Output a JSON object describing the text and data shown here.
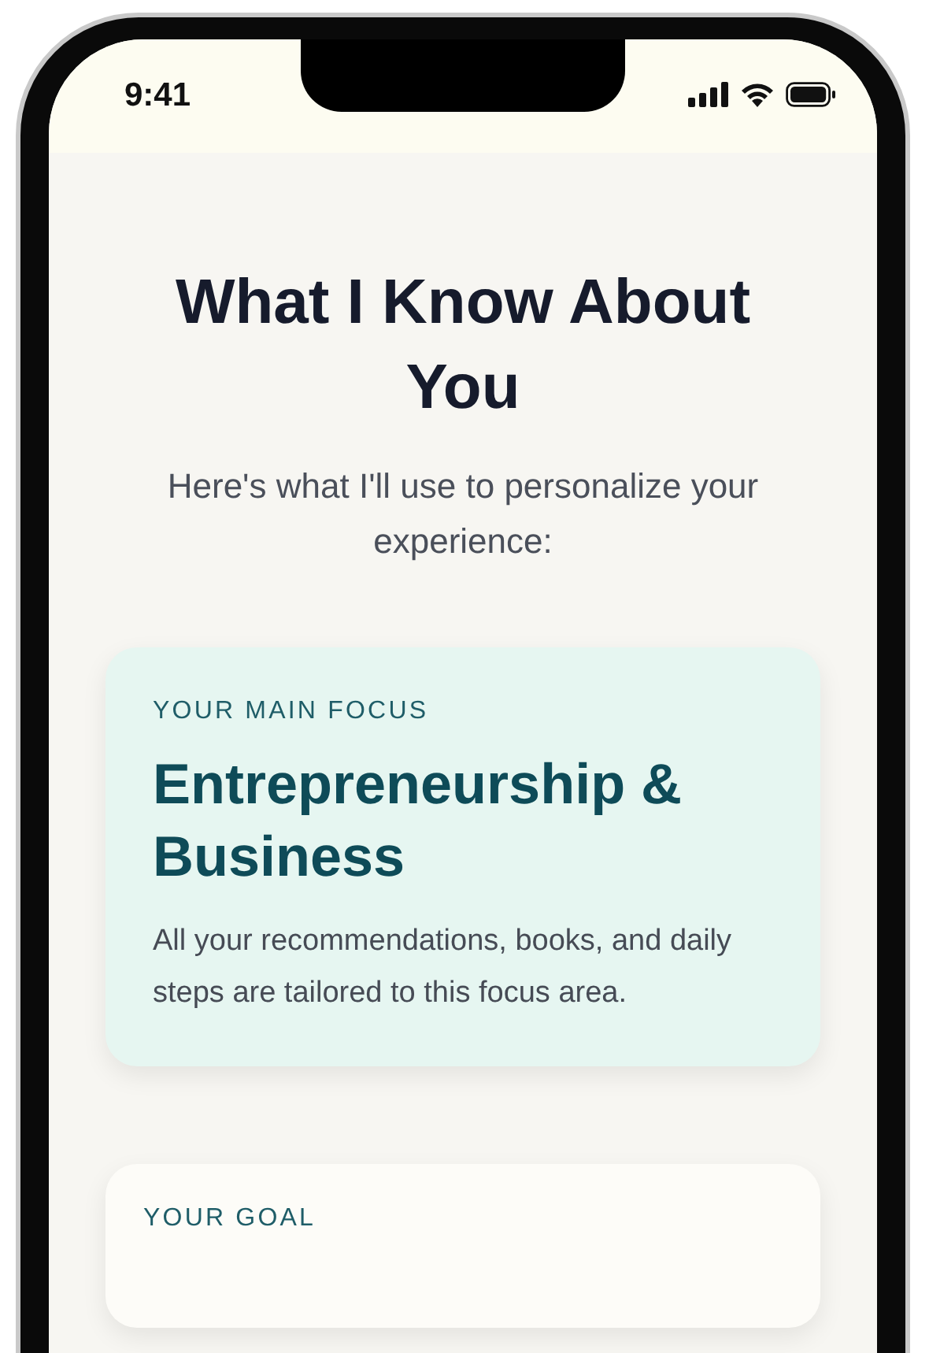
{
  "status_bar": {
    "time": "9:41"
  },
  "title": "What I Know About You",
  "subtitle": "Here's what I'll use to personalize your experience:",
  "cards": [
    {
      "kind": "highlight",
      "label": "YOUR MAIN FOCUS",
      "title": "Entrepreneurship & Business",
      "body": "All your recommendations, books, and daily steps are tailored to this focus area."
    },
    {
      "kind": "plain",
      "label": "YOUR GOAL"
    }
  ]
}
